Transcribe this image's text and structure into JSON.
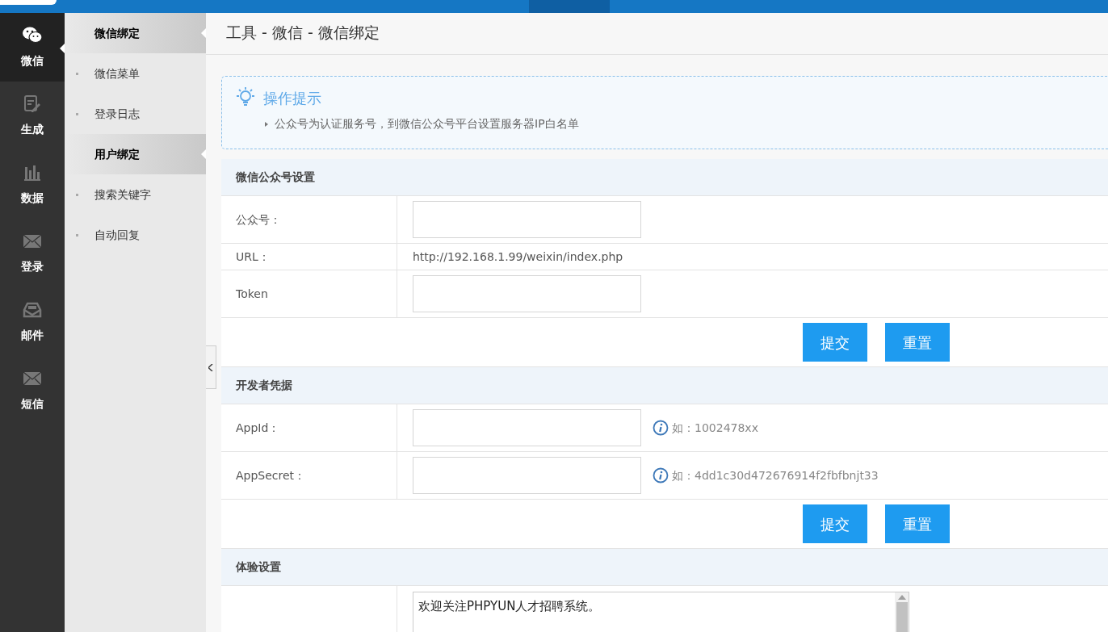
{
  "rail": {
    "items": [
      {
        "label": "微信",
        "selected": true
      },
      {
        "label": "生成",
        "selected": false
      },
      {
        "label": "数据",
        "selected": false
      },
      {
        "label": "登录",
        "selected": false
      },
      {
        "label": "邮件",
        "selected": false
      },
      {
        "label": "短信",
        "selected": false
      }
    ]
  },
  "submenu": {
    "items": [
      {
        "label": "微信绑定",
        "selected": true
      },
      {
        "label": "微信菜单",
        "selected": false
      },
      {
        "label": "登录日志",
        "selected": false
      },
      {
        "label": "用户绑定",
        "selected": true
      },
      {
        "label": "搜索关键字",
        "selected": false
      },
      {
        "label": "自动回复",
        "selected": false
      }
    ]
  },
  "breadcrumb": "工具 - 微信 - 微信绑定",
  "tip": {
    "title": "操作提示",
    "items": [
      "公众号为认证服务号，到微信公众号平台设置服务器IP白名单"
    ]
  },
  "sections": [
    {
      "title": "微信公众号设置",
      "rows": [
        {
          "kind": "input",
          "label": "公众号："
        },
        {
          "kind": "text",
          "label": "URL：",
          "value": "http://192.168.1.99/weixin/index.php"
        },
        {
          "kind": "input",
          "label": "Token"
        }
      ],
      "buttons": [
        "提交",
        "重置"
      ]
    },
    {
      "title": "开发者凭据",
      "rows": [
        {
          "kind": "input",
          "label": "AppId：",
          "hint": "如：1002478xx"
        },
        {
          "kind": "input",
          "label": "AppSecret：",
          "hint": "如：4dd1c30d472676914f2fbfbnjt33"
        }
      ],
      "buttons": [
        "提交",
        "重置"
      ]
    },
    {
      "title": "体验设置",
      "rows": [
        {
          "kind": "textarea",
          "value": "欢迎关注PHPYUN人才招聘系统。"
        }
      ]
    }
  ]
}
